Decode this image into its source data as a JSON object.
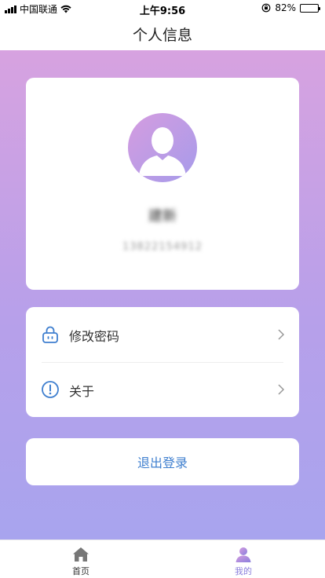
{
  "status_bar": {
    "carrier": "中国联通",
    "time": "上午9:56",
    "battery": "82%",
    "battery_level": 0.82
  },
  "nav": {
    "title": "个人信息"
  },
  "profile": {
    "name": "建新",
    "phone": "13822154912"
  },
  "menu": {
    "items": [
      {
        "label": "修改密码",
        "icon": "lock-icon"
      },
      {
        "label": "关于",
        "icon": "info-icon"
      }
    ]
  },
  "logout": {
    "label": "退出登录"
  },
  "tabbar": {
    "tabs": [
      {
        "label": "首页",
        "icon": "home-icon"
      },
      {
        "label": "我的",
        "icon": "user-icon",
        "active": true
      }
    ]
  },
  "colors": {
    "accent": "#3f7fcf",
    "active_tab": "#8a7fdc",
    "gradient_top": "#d7a2e0",
    "gradient_bottom": "#a8a4ee"
  }
}
